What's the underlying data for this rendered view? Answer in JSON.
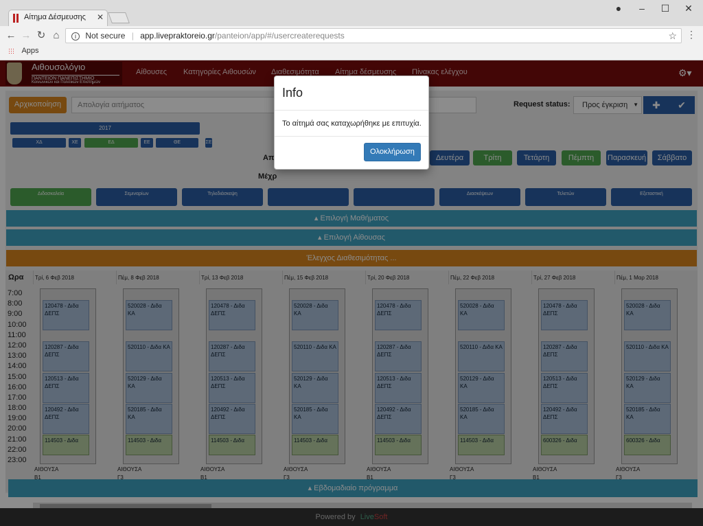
{
  "browser": {
    "tab_title": "Αίτημα Δέσμευσης",
    "tab_close": "✕",
    "address": {
      "security": "Not secure",
      "host": "app.livepraktoreio.gr",
      "path": "/panteion/app/#/usercreaterequests"
    },
    "bookmark": "Apps"
  },
  "app": {
    "logo_title": "Αιθουσολόγιο",
    "logo_sub1": "ΠΑΝΤΕΙΟΝ ΠΑΝΕΠΙΣΤΗΜΙΟ",
    "logo_sub2": "Κοινωνικών και Πολιτικών Επιστημών",
    "nav": [
      "Αίθουσες",
      "Κατηγορίες Αιθουσών",
      "Διαθεσιμότητα",
      "Αίτημα δέσμευσης",
      "Πίνακας ελέγχου"
    ]
  },
  "form": {
    "reset_label": "Αρχικοποίηση",
    "justification_placeholder": "Απολογία αιτήματος",
    "status_label": "Request status:",
    "status_value": "Προς έγκριση",
    "year": "2017",
    "terms": [
      "ΧΔ",
      "ΧΕ",
      "ΕΔ",
      "ΕΕ",
      "ΘΕ",
      "ΣΕ"
    ],
    "from_label": "Απ",
    "until_label": "Μέχρ",
    "days": [
      "Δευτέρα",
      "Τρίτη",
      "Τετάρτη",
      "Πέμπτη",
      "Παρασκευή",
      "Σάββατο"
    ],
    "types": [
      "Διδασκαλεία",
      "Σεμιναρίων",
      "Τηλεδιάσκεψη",
      "",
      "",
      "Διασκέψεων",
      "Τελετών",
      "Εξεταστική"
    ],
    "select_course": "Επιλογή Μαθήματος",
    "select_room": "Επιλογή Αίθουσας",
    "check_availability": "Έλεγχος Διαθεσιμότητας ..."
  },
  "calendar": {
    "hours_header": "Ωρα",
    "hours": [
      "7:00",
      "8:00",
      "9:00",
      "10:00",
      "11:00",
      "12:00",
      "13:00",
      "14:00",
      "15:00",
      "16:00",
      "17:00",
      "18:00",
      "19:00",
      "20:00",
      "21:00",
      "22:00",
      "23:00"
    ],
    "days": [
      {
        "date": "Τρί, 6 Φεβ 2018",
        "room": "ΑΙΘΟΥΣΑ",
        "code": "Β1",
        "events": [
          "120478 - Διδα ΔΕΠΣ",
          "120287 - Διδα ΔΕΠΣ",
          "120513 - Διδα ΔΕΠΣ",
          "120492 - Διδα ΔΕΠΣ"
        ],
        "last": "114503 - Διδα"
      },
      {
        "date": "Πέμ, 8 Φεβ 2018",
        "room": "ΑΙΘΟΥΣΑ",
        "code": "Γ3",
        "events": [
          "520028 - Διδα ΚΑ",
          "520110 - Διδα ΚΑ",
          "520129 - Διδα ΚΑ",
          "520185 - Διδα ΚΑ"
        ],
        "last": "114503 - Διδα"
      },
      {
        "date": "Τρί, 13 Φεβ 2018",
        "room": "ΑΙΘΟΥΣΑ",
        "code": "Β1",
        "events": [
          "120478 - Διδα ΔΕΠΣ",
          "120287 - Διδα ΔΕΠΣ",
          "120513 - Διδα ΔΕΠΣ",
          "120492 - Διδα ΔΕΠΣ"
        ],
        "last": "114503 - Διδα"
      },
      {
        "date": "Πέμ, 15 Φεβ 2018",
        "room": "ΑΙΘΟΥΣΑ",
        "code": "Γ3",
        "events": [
          "520028 - Διδα ΚΑ",
          "520110 - Διδα ΚΑ",
          "520129 - Διδα ΚΑ",
          "520185 - Διδα ΚΑ"
        ],
        "last": "114503 - Διδα"
      },
      {
        "date": "Τρί, 20 Φεβ 2018",
        "room": "ΑΙΘΟΥΣΑ",
        "code": "Β1",
        "events": [
          "120478 - Διδα ΔΕΠΣ",
          "120287 - Διδα ΔΕΠΣ",
          "120513 - Διδα ΔΕΠΣ",
          "120492 - Διδα ΔΕΠΣ"
        ],
        "last": "114503 - Διδα"
      },
      {
        "date": "Πέμ, 22 Φεβ 2018",
        "room": "ΑΙΘΟΥΣΑ",
        "code": "Γ3",
        "events": [
          "520028 - Διδα ΚΑ",
          "520110 - Διδα ΚΑ",
          "520129 - Διδα ΚΑ",
          "520185 - Διδα ΚΑ"
        ],
        "last": "114503 - Διδα"
      },
      {
        "date": "Τρί, 27 Φεβ 2018",
        "room": "ΑΙΘΟΥΣΑ",
        "code": "Β1",
        "events": [
          "120478 - Διδα ΔΕΠΣ",
          "120287 - Διδα ΔΕΠΣ",
          "120513 - Διδα ΔΕΠΣ",
          "120492 - Διδα ΔΕΠΣ"
        ],
        "last": "600326 - Διδα"
      },
      {
        "date": "Πέμ, 1 Μαρ 2018",
        "room": "ΑΙΘΟΥΣΑ",
        "code": "Γ3",
        "events": [
          "520028 - Διδα ΚΑ",
          "520110 - Διδα ΚΑ",
          "520129 - Διδα ΚΑ",
          "520185 - Διδα ΚΑ"
        ],
        "last": "600326 - Διδα"
      }
    ]
  },
  "weekly_schedule": "Εβδομαδιαίο πρόγραμμα",
  "footer": {
    "powered_by": "Powered by",
    "brand_a": "Live",
    "brand_b": "Soft"
  },
  "modal": {
    "title": "Info",
    "message": "Το αίτημά σας καταχωρήθηκε με επιτυχία.",
    "ok_label": "Ολοκλήρωση"
  }
}
